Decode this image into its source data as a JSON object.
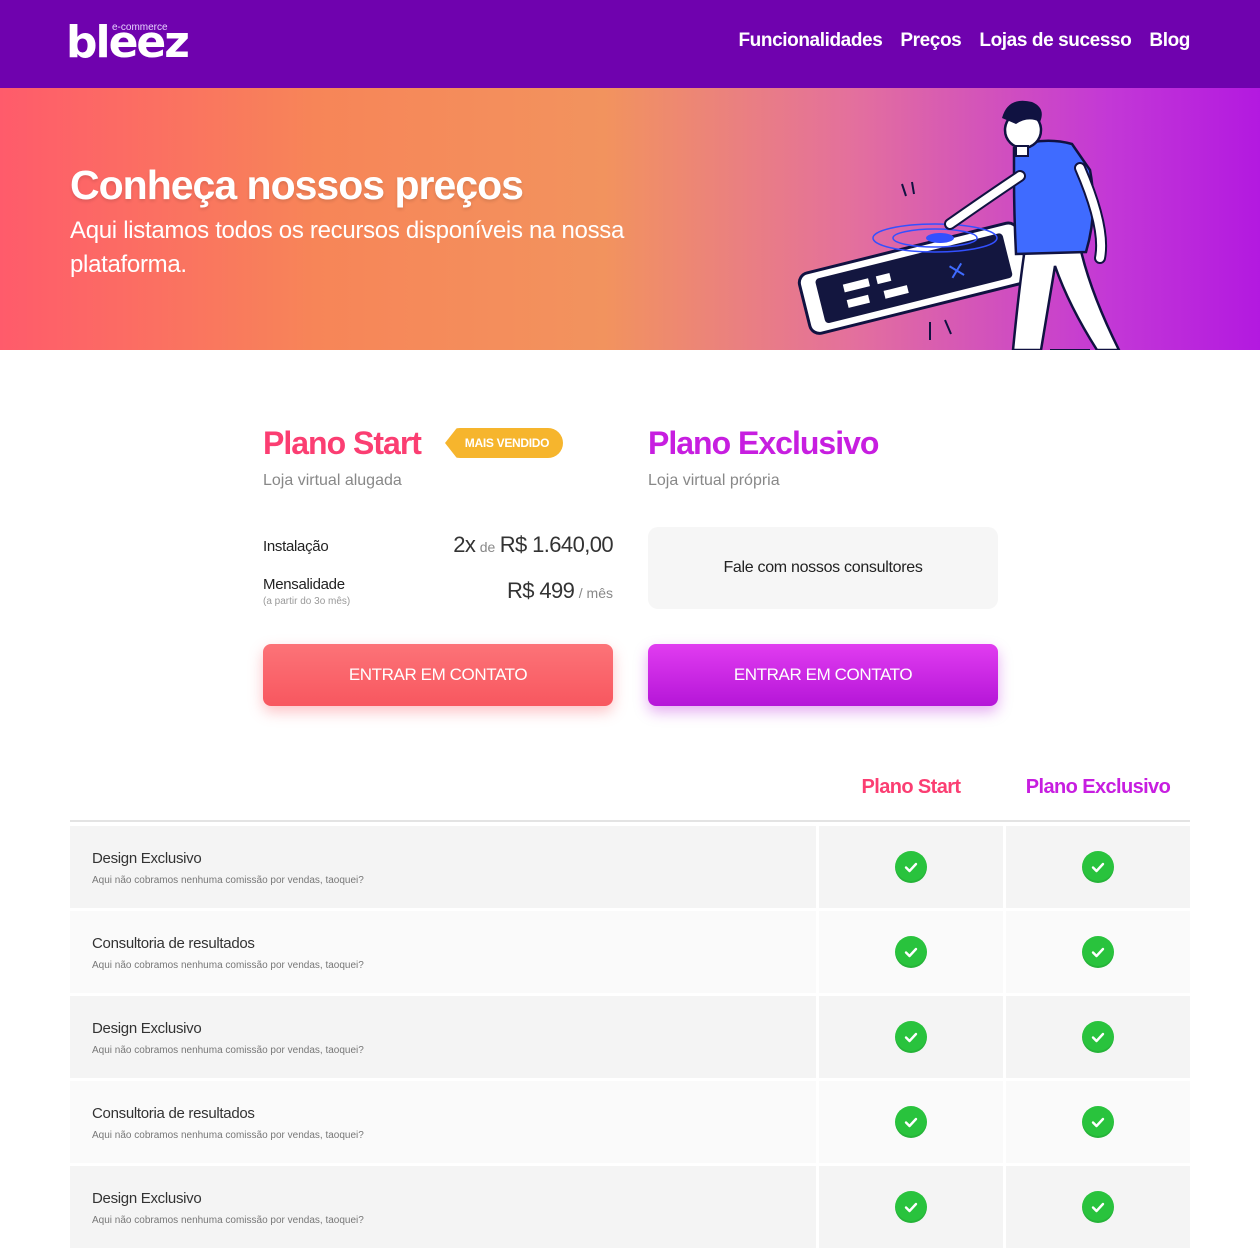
{
  "header": {
    "logo": "bleez",
    "logo_tag": "e-commerce",
    "nav": [
      "Funcionalidades",
      "Preços",
      "Lojas de sucesso",
      "Blog"
    ]
  },
  "hero": {
    "title": "Conheça nossos preços",
    "subtitle": "Aqui listamos todos os recursos disponíveis na nossa plataforma."
  },
  "plans": {
    "start": {
      "title": "Plano Start",
      "badge": "MAIS VENDIDO",
      "subtitle": "Loja virtual alugada",
      "install_label": "Instalação",
      "install_times": "2x",
      "install_de": "de",
      "install_value": "R$ 1.640,00",
      "monthly_label": "Mensalidade",
      "monthly_note": "(a partir do 3o mês)",
      "monthly_value": "R$ 499",
      "monthly_unit": "/ mês",
      "cta": "ENTRAR EM CONTATO"
    },
    "exclusive": {
      "title": "Plano Exclusivo",
      "subtitle": "Loja virtual própria",
      "consult": "Fale com nossos consultores",
      "cta": "ENTRAR EM CONTATO"
    }
  },
  "comparison": {
    "col_start": "Plano Start",
    "col_exclusive": "Plano Exclusivo",
    "rows": [
      {
        "name": "Design Exclusivo",
        "desc": "Aqui não cobramos nenhuma comissão por vendas, taoquei?"
      },
      {
        "name": "Consultoria de resultados",
        "desc": "Aqui não cobramos nenhuma comissão por vendas, taoquei?"
      },
      {
        "name": "Design Exclusivo",
        "desc": "Aqui não cobramos nenhuma comissão por vendas, taoquei?"
      },
      {
        "name": "Consultoria de resultados",
        "desc": "Aqui não cobramos nenhuma comissão por vendas, taoquei?"
      },
      {
        "name": "Design Exclusivo",
        "desc": "Aqui não cobramos nenhuma comissão por vendas, taoquei?"
      }
    ]
  },
  "colors": {
    "nav_bg": "#6f02ae",
    "start": "#fb3e72",
    "exclusive": "#c71ee0",
    "badge": "#f6b52d",
    "check": "#29c33d"
  },
  "icons": {
    "check": "check-circle-icon",
    "hero_illustration": "person-with-tablet-illustration"
  }
}
